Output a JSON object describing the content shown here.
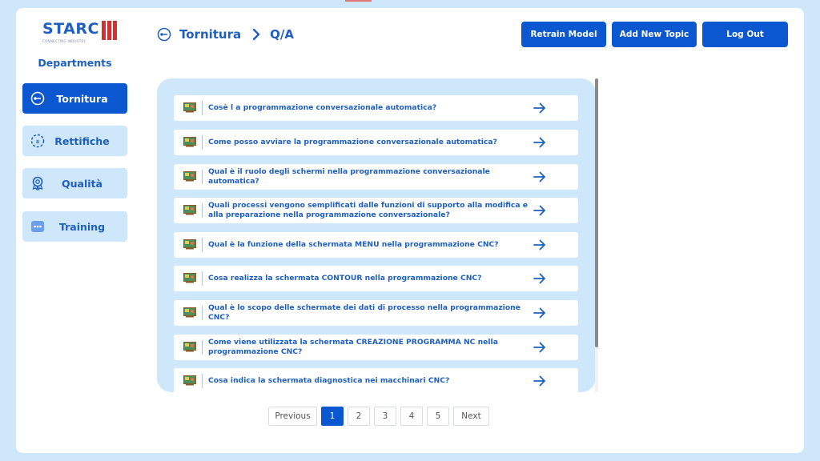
{
  "logo": {
    "brand": "STARC",
    "tagline": "CONNECTING INDUSTRY"
  },
  "departments_title": "Departments",
  "nav": [
    {
      "label": "Tornitura",
      "icon": "lathe-icon",
      "active": true
    },
    {
      "label": "Rettifiche",
      "icon": "grinder-icon",
      "active": false
    },
    {
      "label": "Qualità",
      "icon": "quality-badge-icon",
      "active": false
    },
    {
      "label": "Training",
      "icon": "dots-icon",
      "active": false
    }
  ],
  "breadcrumb": {
    "department": "Tornitura",
    "section": "Q/A"
  },
  "header_buttons": {
    "retrain": "Retrain Model",
    "add_topic": "Add New Topic",
    "logout": "Log Out"
  },
  "questions": [
    "Cosè l a programmazione conversazionale automatica?",
    "Come posso avviare la programmazione conversazionale automatica?",
    "Qual è il ruolo degli schermi nella programmazione conversazionale automatica?",
    "Quali processi vengono semplificati dalle funzioni di supporto alla modifica e alla preparazione nella programmazione conversazionale?",
    "Qual è la funzione della schermata MENU nella programmazione CNC?",
    "Cosa realizza la schermata CONTOUR nella programmazione CNC?",
    "Qual è lo scopo delle schermate dei dati di processo nella programmazione CNC?",
    "Come viene utilizzata la schermata CREAZIONE PROGRAMMA NC nella programmazione CNC?",
    "Cosa indica la schermata diagnostica nei macchinari CNC?"
  ],
  "pagination": {
    "prev": "Previous",
    "next": "Next",
    "pages": [
      "1",
      "2",
      "3",
      "4",
      "5"
    ],
    "current": "1"
  },
  "colors": {
    "primary": "#0b57d0",
    "text_blue": "#1f5fbf",
    "panel_bg": "#cfe7fb",
    "logo_red": "#d63031"
  }
}
